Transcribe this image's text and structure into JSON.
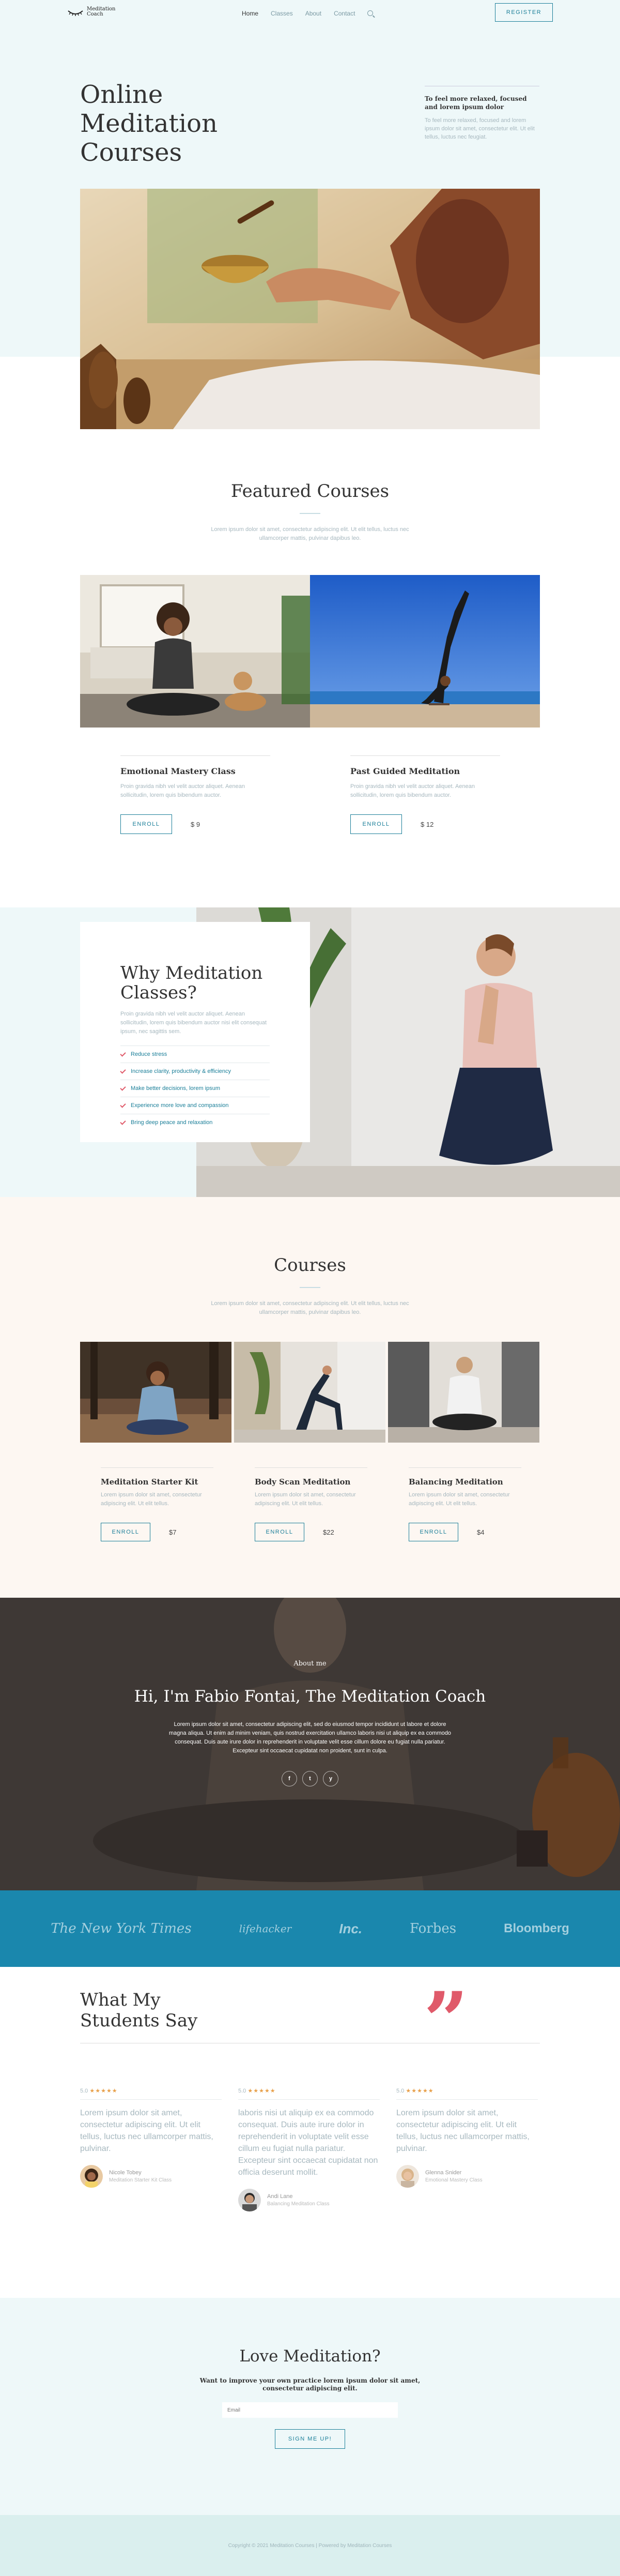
{
  "nav": {
    "logo_line1": "Meditation",
    "logo_line2": "Coach",
    "items": [
      "Home",
      "Classes",
      "About",
      "Contact"
    ],
    "register_label": "REGISTER"
  },
  "hero": {
    "title_lines": [
      "Online",
      "Meditation",
      "Courses"
    ],
    "side_title": "To feel more relaxed, focused and lorem ipsum dolor",
    "side_text": "To feel more relaxed, focused and lorem ipsum dolor sit amet, consectetur elit. Ut elit tellus, luctus nec feugiat."
  },
  "featured": {
    "title": "Featured Courses",
    "subtitle": "Lorem ipsum dolor sit amet, consectetur adipiscing elit. Ut elit tellus, luctus nec ullamcorper mattis, pulvinar dapibus leo.",
    "cards": [
      {
        "title": "Emotional Mastery Class",
        "text": "Proin gravida nibh vel velit auctor aliquet. Aenean sollicitudin, lorem quis bibendum auctor.",
        "button": "ENROLL",
        "price": "$ 9"
      },
      {
        "title": "Past Guided Meditation",
        "text": "Proin gravida nibh vel velit auctor aliquet. Aenean sollicitudin, lorem quis bibendum auctor.",
        "button": "ENROLL",
        "price": "$ 12"
      }
    ]
  },
  "why": {
    "title": "Why Meditation Classes?",
    "text": "Proin gravida nibh vel velit auctor aliquet. Aenean sollicitudin, lorem quis bibendum auctor nisi elit consequat ipsum, nec sagittis sem.",
    "items": [
      "Reduce stress",
      "Increase clarity, productivity & efficiency",
      "Make better decisions, lorem ipsum",
      "Experience more love and compassion",
      "Bring deep peace and relaxation"
    ]
  },
  "courses": {
    "title": "Courses",
    "subtitle": "Lorem ipsum dolor sit amet, consectetur adipiscing elit. Ut elit tellus, luctus nec ullamcorper mattis, pulvinar dapibus leo.",
    "cards": [
      {
        "title": "Meditation Starter Kit",
        "text": "Lorem ipsum dolor sit amet, consectetur adipiscing elit. Ut elit tellus.",
        "button": "ENROLL",
        "price": "$7"
      },
      {
        "title": "Body Scan Meditation",
        "text": "Lorem ipsum dolor sit amet, consectetur adipiscing elit. Ut elit tellus.",
        "button": "ENROLL",
        "price": "$22"
      },
      {
        "title": "Balancing Meditation",
        "text": "Lorem ipsum dolor sit amet, consectetur adipiscing elit. Ut elit tellus.",
        "button": "ENROLL",
        "price": "$4"
      }
    ]
  },
  "about": {
    "label": "About me",
    "title": "Hi, I'm Fabio Fontai, The Meditation Coach",
    "text": "Lorem ipsum dolor sit amet, consectetur adipiscing elit, sed do eiusmod tempor incididunt ut labore et dolore magna aliqua. Ut enim ad minim veniam, quis nostrud exercitation ullamco laboris nisi ut aliquip ex ea commodo consequat. Duis aute irure dolor in reprehenderit in voluptate velit esse cillum dolore eu fugiat nulla pariatur. Excepteur sint occaecat cupidatat non proident, sunt in culpa.",
    "social": [
      "f",
      "t",
      "y"
    ]
  },
  "logos": [
    "The New York Times",
    "lifehacker",
    "Inc.",
    "Forbes",
    "Bloomberg"
  ],
  "testimonials": {
    "title_lines": [
      "What My",
      "Students Say"
    ],
    "quote_glyph": "”",
    "items": [
      {
        "score": "5.0",
        "stars": "★★★★★",
        "text": "Lorem ipsum dolor sit amet, consectetur adipiscing elit. Ut elit tellus, luctus nec ullamcorper mattis, pulvinar.",
        "name": "Nicole Tobey",
        "role": "Meditation Starter Kit Class"
      },
      {
        "score": "5.0",
        "stars": "★★★★★",
        "text": "laboris nisi ut aliquip ex ea commodo consequat. Duis aute irure dolor in reprehenderit in voluptate velit esse cillum eu fugiat nulla pariatur. Excepteur sint occaecat cupidatat non officia deserunt mollit.",
        "name": "Andi Lane",
        "role": "Balancing Meditation Class"
      },
      {
        "score": "5.0",
        "stars": "★★★★★",
        "text": "Lorem ipsum dolor sit amet, consectetur adipiscing elit. Ut elit tellus, luctus nec ullamcorper mattis, pulvinar.",
        "name": "Glenna Snider",
        "role": "Emotional Mastery Class"
      }
    ]
  },
  "newsletter": {
    "title": "Love Meditation?",
    "text": "Want to improve your own practice lorem ipsum dolor sit amet, consectetur adipiscing elit.",
    "placeholder": "Email",
    "button": "SIGN ME UP!"
  },
  "footer": {
    "text": "Copyright © 2021 Meditation Courses | Powered by Meditation Courses"
  },
  "colors": {
    "accent": "#1b7f99",
    "highlight": "#e05a6a",
    "light_bg": "#eef8f9",
    "cream_bg": "#fdf7f2",
    "logo_bar": "#1a87ad"
  }
}
